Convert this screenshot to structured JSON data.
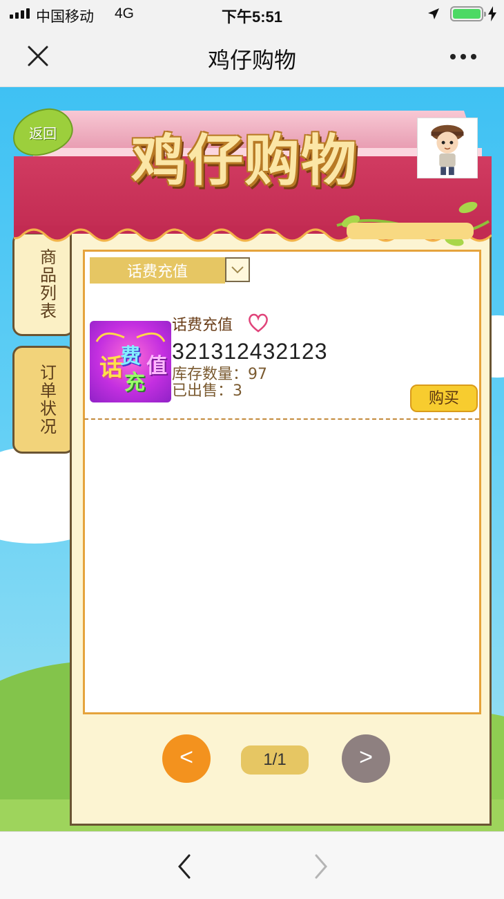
{
  "status_bar": {
    "carrier": "中国移动",
    "network": "4G",
    "time": "下午5:51",
    "battery_color": "#4cd964"
  },
  "nav_bar": {
    "title": "鸡仔购物",
    "close_icon": "close-icon",
    "more_icon": "more-icon"
  },
  "shop": {
    "title": "鸡仔购物",
    "back_label": "返回",
    "accent_color": "#c22b52"
  },
  "side_tabs": [
    {
      "label": "商品列表"
    },
    {
      "label": "订单状况"
    }
  ],
  "filter": {
    "selected": "话费充值"
  },
  "products": [
    {
      "name": "话费充值",
      "code": "321312432123",
      "stock": "库存数量：97",
      "sold": "已出售：3",
      "buy_label": "购买",
      "image_text": [
        "话",
        "费",
        "充",
        "值"
      ]
    }
  ],
  "pagination": {
    "prev": "<",
    "indicator": "1/1",
    "next": ">"
  },
  "toolbar": {
    "back_icon": "chevron-left-icon",
    "forward_icon": "chevron-right-icon"
  }
}
